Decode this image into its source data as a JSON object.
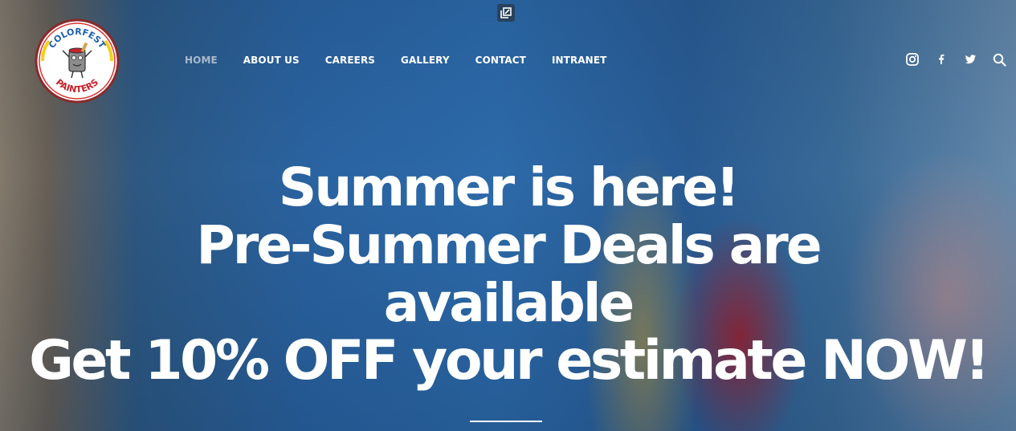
{
  "page": {
    "background_colors": {
      "blue": "#2c67a6",
      "red_accent": "#aa1e28",
      "text": "#ffffff",
      "nav_active": "#aab8cc"
    }
  },
  "logo": {
    "top_text": "COLORFEST",
    "bottom_text": "PAINTERS",
    "icon": "paint-can-mascot-icon"
  },
  "toolbar": {
    "popout_icon": "popout-icon"
  },
  "nav": {
    "items": [
      {
        "label": "HOME",
        "active": true
      },
      {
        "label": "ABOUT US",
        "active": false
      },
      {
        "label": "CAREERS",
        "active": false
      },
      {
        "label": "GALLERY",
        "active": false
      },
      {
        "label": "CONTACT",
        "active": false
      },
      {
        "label": "INTRANET",
        "active": false
      }
    ]
  },
  "social": {
    "icons": [
      "instagram-icon",
      "facebook-icon",
      "twitter-icon",
      "search-icon"
    ]
  },
  "hero": {
    "line1": "Summer is here!",
    "line2": "Pre-Summer Deals are",
    "line3": "available",
    "line4": "Get 10% OFF your estimate NOW!"
  }
}
